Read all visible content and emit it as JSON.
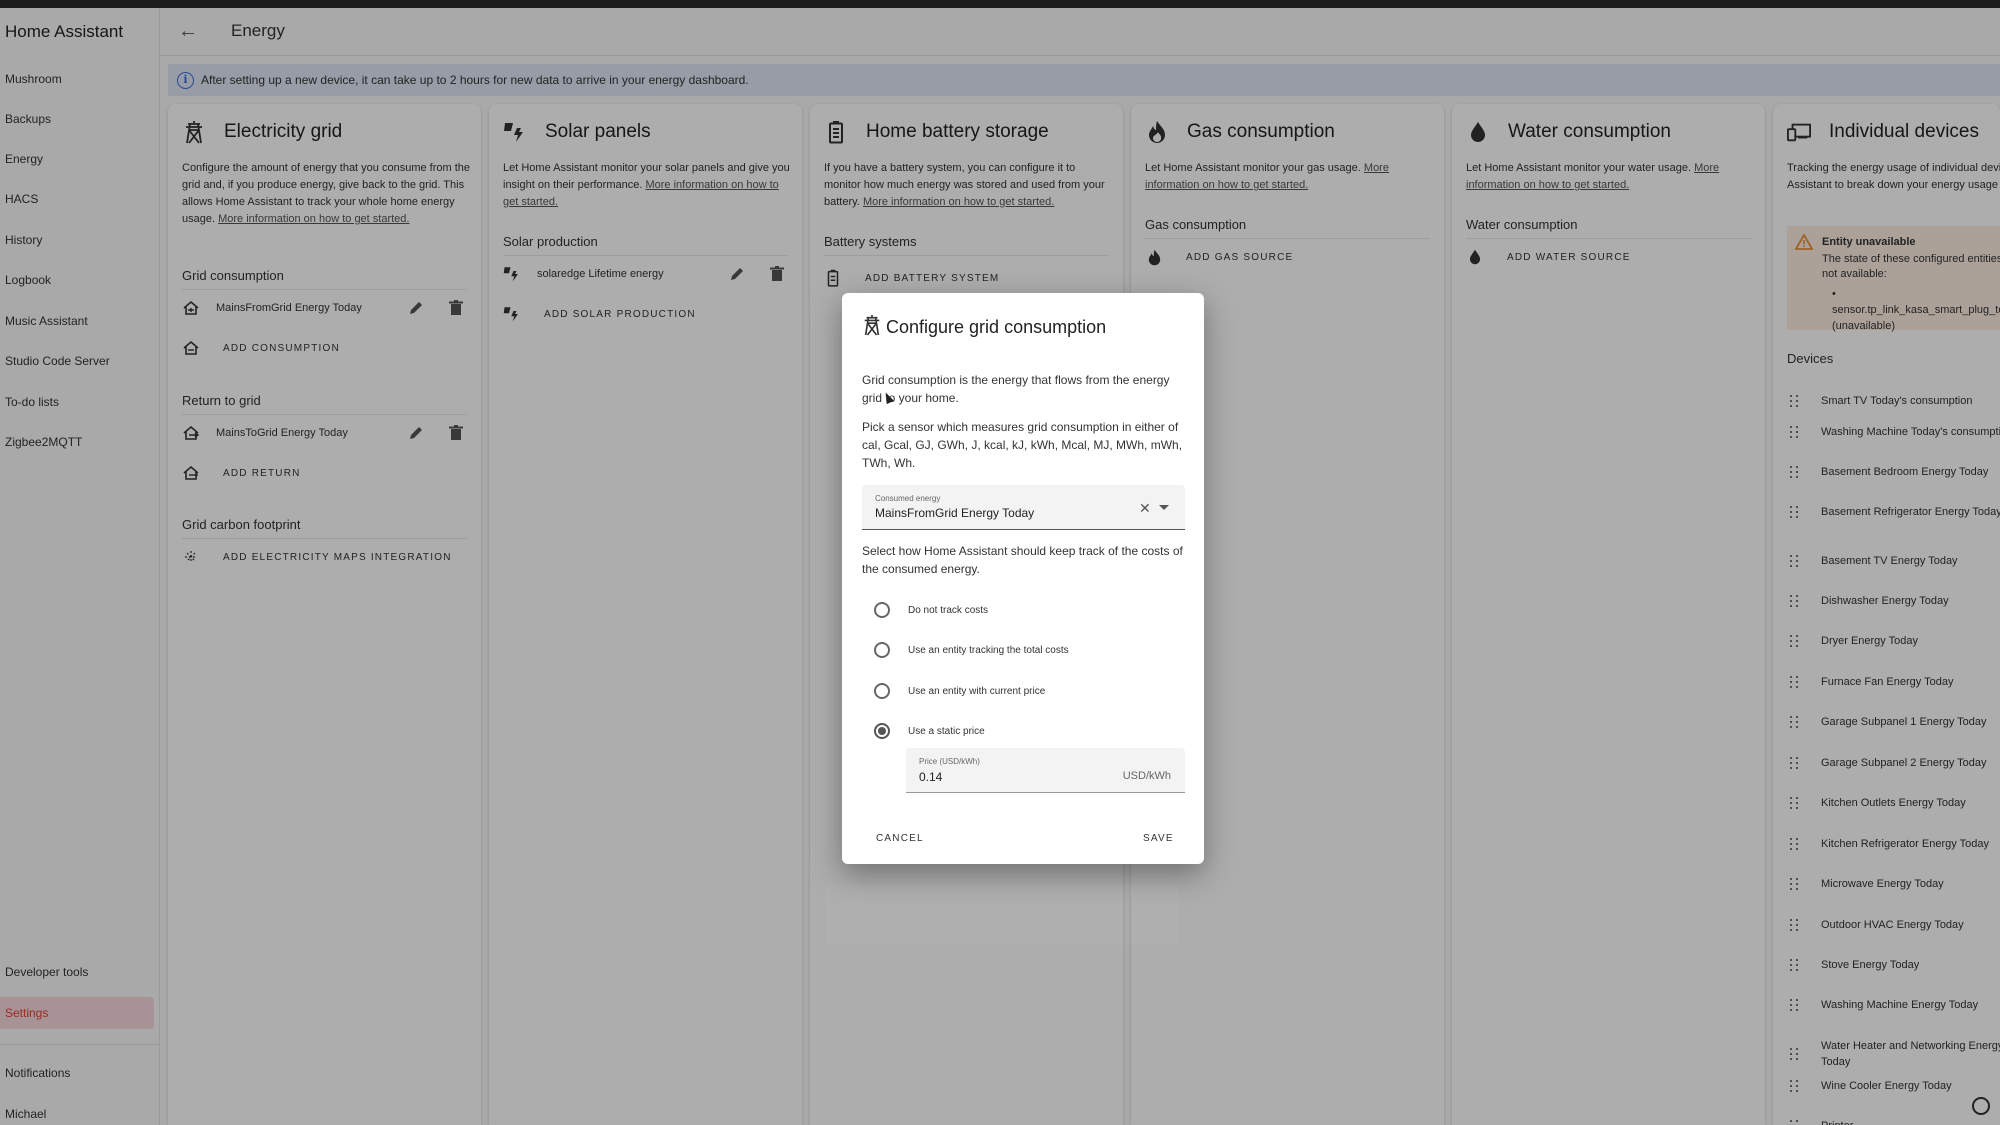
{
  "sidebar": {
    "title": "Home Assistant",
    "items": [
      "Mushroom",
      "Backups",
      "Energy",
      "HACS",
      "History",
      "Logbook",
      "Music Assistant",
      "Studio Code Server",
      "To-do lists",
      "Zigbee2MQTT"
    ],
    "developer_tools": "Developer tools",
    "settings": "Settings",
    "notifications": "Notifications",
    "user": "Michael"
  },
  "topbar": {
    "title": "Energy"
  },
  "info_banner": "After setting up a new device, it can take up to 2 hours for new data to arrive in your energy dashboard.",
  "cards": {
    "grid": {
      "title": "Electricity grid",
      "desc": "Configure the amount of energy that you consume from the grid and, if you produce energy, give back to the grid. This allows Home Assistant to track your whole home energy usage.",
      "link": "More information on how to get started.",
      "consumption_header": "Grid consumption",
      "consumption_item": "MainsFromGrid Energy Today",
      "add_consumption": "ADD CONSUMPTION",
      "return_header": "Return to grid",
      "return_item": "MainsToGrid Energy Today",
      "add_return": "ADD RETURN",
      "carbon_header": "Grid carbon footprint",
      "add_carbon": "ADD ELECTRICITY MAPS INTEGRATION"
    },
    "solar": {
      "title": "Solar panels",
      "desc": "Let Home Assistant monitor your solar panels and give you insight on their performance.",
      "link": "More information on how to get started.",
      "production_header": "Solar production",
      "production_item": "solaredge Lifetime energy",
      "add_production": "ADD SOLAR PRODUCTION"
    },
    "battery": {
      "title": "Home battery storage",
      "desc": "If you have a battery system, you can configure it to monitor how much energy was stored and used from your battery.",
      "link": "More information on how to get started.",
      "header": "Battery systems",
      "add": "ADD BATTERY SYSTEM"
    },
    "gas": {
      "title": "Gas consumption",
      "desc": "Let Home Assistant monitor your gas usage.",
      "link": "More information on how to get started.",
      "header": "Gas consumption",
      "add": "ADD GAS SOURCE"
    },
    "water": {
      "title": "Water consumption",
      "desc": "Let Home Assistant monitor your water usage.",
      "link": "More information on how to get started.",
      "header": "Water consumption",
      "add": "ADD WATER SOURCE"
    },
    "devices": {
      "title": "Individual devices",
      "desc": "Tracking the energy usage of individual devices allows Home Assistant to break down your energy usage by device.",
      "link": "More information on how to get started.",
      "warning_title": "Entity unavailable",
      "warning_text": "The state of these configured entities are currently not available:",
      "warning_entity": "sensor.tp_link_kasa_smart_plug_today_s_consumption (unavailable)",
      "header": "Devices",
      "list": [
        "Smart TV Today's consumption",
        "Washing Machine Today's consumption",
        "Basement Bedroom Energy Today",
        "Basement Refrigerator Energy Today",
        "Basement TV Energy Today",
        "Dishwasher Energy Today",
        "Dryer Energy Today",
        "Furnace Fan Energy Today",
        "Garage Subpanel 1 Energy Today",
        "Garage Subpanel 2 Energy Today",
        "Kitchen Outlets Energy Today",
        "Kitchen Refrigerator Energy Today",
        "Microwave Energy Today",
        "Outdoor HVAC Energy Today",
        "Stove Energy Today",
        "Washing Machine Energy Today",
        "Water Heater and Networking Energy Today",
        "Wine Cooler Energy Today",
        "Printer"
      ]
    }
  },
  "dialog": {
    "title": "Configure grid consumption",
    "p1": "Grid consumption is the energy that flows from the energy grid to your home.",
    "p2": "Pick a sensor which measures grid consumption in either of cal, Gcal, GJ, GWh, J, kcal, kJ, kWh, Mcal, MJ, MWh, mWh, TWh, Wh.",
    "field_label": "Consumed energy",
    "field_value": "MainsFromGrid Energy Today",
    "p3": "Select how Home Assistant should keep track of the costs of the consumed energy.",
    "options": [
      "Do not track costs",
      "Use an entity tracking the total costs",
      "Use an entity with current price",
      "Use a static price"
    ],
    "selected_option": "Use a static price",
    "price_label": "Price (USD/kWh)",
    "price_value": "0.14",
    "price_suffix": "USD/kWh",
    "cancel": "CANCEL",
    "save": "SAVE"
  },
  "colors": {
    "accent": "#db4437",
    "info": "#3f6fd6",
    "warning": "#e8913a"
  }
}
